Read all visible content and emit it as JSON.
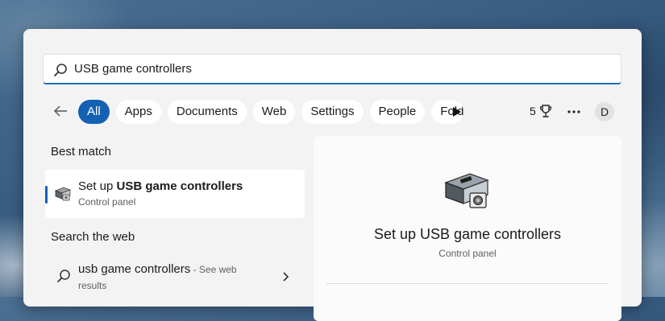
{
  "search": {
    "value": "USB game controllers",
    "placeholder": ""
  },
  "filters": {
    "items": [
      "All",
      "Apps",
      "Documents",
      "Web",
      "Settings",
      "People",
      "Folders"
    ],
    "active": "All",
    "count": "5",
    "avatar_letter": "D"
  },
  "best_match": {
    "heading": "Best match",
    "title_prefix": "Set up ",
    "title_bold": "USB game controllers",
    "subtitle": "Control panel"
  },
  "web": {
    "heading": "Search the web",
    "query": "usb game controllers",
    "suffix": " - See web",
    "suffix_line2": "results"
  },
  "preview": {
    "title": "Set up USB game controllers",
    "subtitle": "Control panel"
  },
  "icons": {
    "search": "search-icon",
    "back": "back-arrow-icon",
    "play": "play-icon",
    "trophy": "trophy-icon",
    "more": "more-icon",
    "chevron": "chevron-right-icon",
    "app": "game-controllers-icon"
  },
  "colors": {
    "accent": "#1461b4",
    "panel": "#f3f3f3"
  }
}
